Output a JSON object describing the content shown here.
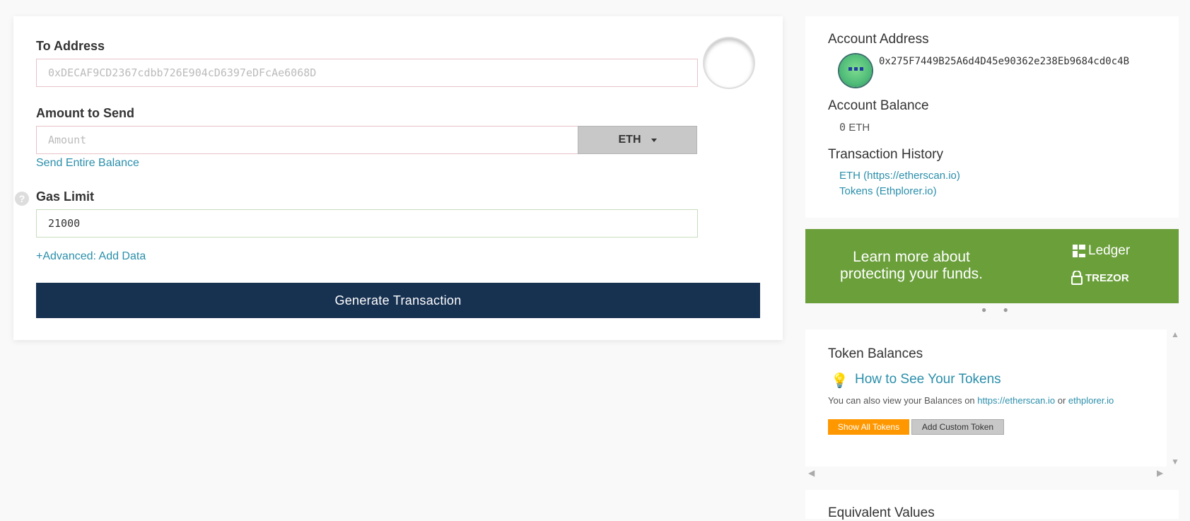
{
  "send_form": {
    "to_address_label": "To Address",
    "to_address_placeholder": "0xDECAF9CD2367cdbb726E904cD6397eDFcAe6068D",
    "amount_label": "Amount to Send",
    "amount_placeholder": "Amount",
    "unit_selected": "ETH",
    "send_entire_balance": "Send Entire Balance",
    "gas_limit_label": "Gas Limit",
    "gas_limit_value": "21000",
    "help_icon_glyph": "?",
    "advanced_link": "+Advanced: Add Data",
    "generate_button": "Generate Transaction"
  },
  "sidebar": {
    "account_address_title": "Account Address",
    "account_address": "0x275F7449B25A6d4D45e90362e238Eb9684cd0c4B",
    "account_balance_title": "Account Balance",
    "balance_amount": "0",
    "balance_unit": "ETH",
    "tx_history_title": "Transaction History",
    "tx_links": [
      "ETH (https://etherscan.io)",
      "Tokens (Ethplorer.io)"
    ],
    "promo_text": "Learn more about protecting your funds.",
    "promo_ledger": "Ledger",
    "promo_trezor": "TREZOR",
    "token_balances_title": "Token Balances",
    "how_to_link": "How to See Your Tokens",
    "view_balances_prefix": "You can also view your Balances on ",
    "etherscan_link": "https://etherscan.io",
    "or_text": " or ",
    "ethplorer_link": "ethplorer.io",
    "show_all_tokens": "Show All Tokens",
    "add_custom_token": "Add Custom Token",
    "equivalent_values_title": "Equivalent Values"
  },
  "colors": {
    "primary_button": "#173151",
    "link": "#2b8fab",
    "promo_bg": "#6a9f3a",
    "show_tokens_bg": "#ff9800",
    "add_token_bg": "#c8c8c8"
  },
  "icons": {
    "help": "question-circle-icon",
    "caret": "chevron-down-icon",
    "bulb": "lightbulb-icon",
    "ledger": "ledger-logo",
    "trezor": "trezor-lock-logo"
  }
}
